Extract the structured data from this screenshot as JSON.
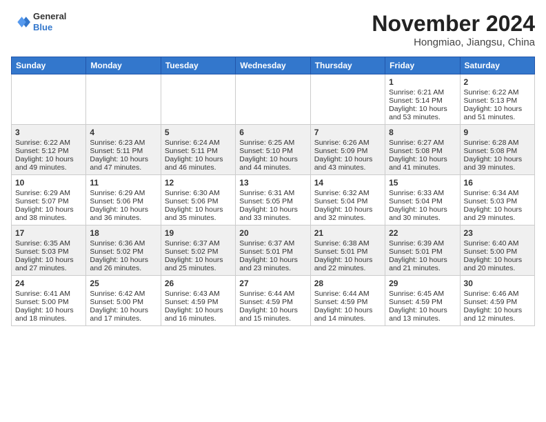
{
  "header": {
    "logo_line1": "General",
    "logo_line2": "Blue",
    "title": "November 2024",
    "subtitle": "Hongmiao, Jiangsu, China"
  },
  "weekdays": [
    "Sunday",
    "Monday",
    "Tuesday",
    "Wednesday",
    "Thursday",
    "Friday",
    "Saturday"
  ],
  "weeks": [
    [
      {
        "day": "",
        "info": ""
      },
      {
        "day": "",
        "info": ""
      },
      {
        "day": "",
        "info": ""
      },
      {
        "day": "",
        "info": ""
      },
      {
        "day": "",
        "info": ""
      },
      {
        "day": "1",
        "info": "Sunrise: 6:21 AM\nSunset: 5:14 PM\nDaylight: 10 hours\nand 53 minutes."
      },
      {
        "day": "2",
        "info": "Sunrise: 6:22 AM\nSunset: 5:13 PM\nDaylight: 10 hours\nand 51 minutes."
      }
    ],
    [
      {
        "day": "3",
        "info": "Sunrise: 6:22 AM\nSunset: 5:12 PM\nDaylight: 10 hours\nand 49 minutes."
      },
      {
        "day": "4",
        "info": "Sunrise: 6:23 AM\nSunset: 5:11 PM\nDaylight: 10 hours\nand 47 minutes."
      },
      {
        "day": "5",
        "info": "Sunrise: 6:24 AM\nSunset: 5:11 PM\nDaylight: 10 hours\nand 46 minutes."
      },
      {
        "day": "6",
        "info": "Sunrise: 6:25 AM\nSunset: 5:10 PM\nDaylight: 10 hours\nand 44 minutes."
      },
      {
        "day": "7",
        "info": "Sunrise: 6:26 AM\nSunset: 5:09 PM\nDaylight: 10 hours\nand 43 minutes."
      },
      {
        "day": "8",
        "info": "Sunrise: 6:27 AM\nSunset: 5:08 PM\nDaylight: 10 hours\nand 41 minutes."
      },
      {
        "day": "9",
        "info": "Sunrise: 6:28 AM\nSunset: 5:08 PM\nDaylight: 10 hours\nand 39 minutes."
      }
    ],
    [
      {
        "day": "10",
        "info": "Sunrise: 6:29 AM\nSunset: 5:07 PM\nDaylight: 10 hours\nand 38 minutes."
      },
      {
        "day": "11",
        "info": "Sunrise: 6:29 AM\nSunset: 5:06 PM\nDaylight: 10 hours\nand 36 minutes."
      },
      {
        "day": "12",
        "info": "Sunrise: 6:30 AM\nSunset: 5:06 PM\nDaylight: 10 hours\nand 35 minutes."
      },
      {
        "day": "13",
        "info": "Sunrise: 6:31 AM\nSunset: 5:05 PM\nDaylight: 10 hours\nand 33 minutes."
      },
      {
        "day": "14",
        "info": "Sunrise: 6:32 AM\nSunset: 5:04 PM\nDaylight: 10 hours\nand 32 minutes."
      },
      {
        "day": "15",
        "info": "Sunrise: 6:33 AM\nSunset: 5:04 PM\nDaylight: 10 hours\nand 30 minutes."
      },
      {
        "day": "16",
        "info": "Sunrise: 6:34 AM\nSunset: 5:03 PM\nDaylight: 10 hours\nand 29 minutes."
      }
    ],
    [
      {
        "day": "17",
        "info": "Sunrise: 6:35 AM\nSunset: 5:03 PM\nDaylight: 10 hours\nand 27 minutes."
      },
      {
        "day": "18",
        "info": "Sunrise: 6:36 AM\nSunset: 5:02 PM\nDaylight: 10 hours\nand 26 minutes."
      },
      {
        "day": "19",
        "info": "Sunrise: 6:37 AM\nSunset: 5:02 PM\nDaylight: 10 hours\nand 25 minutes."
      },
      {
        "day": "20",
        "info": "Sunrise: 6:37 AM\nSunset: 5:01 PM\nDaylight: 10 hours\nand 23 minutes."
      },
      {
        "day": "21",
        "info": "Sunrise: 6:38 AM\nSunset: 5:01 PM\nDaylight: 10 hours\nand 22 minutes."
      },
      {
        "day": "22",
        "info": "Sunrise: 6:39 AM\nSunset: 5:01 PM\nDaylight: 10 hours\nand 21 minutes."
      },
      {
        "day": "23",
        "info": "Sunrise: 6:40 AM\nSunset: 5:00 PM\nDaylight: 10 hours\nand 20 minutes."
      }
    ],
    [
      {
        "day": "24",
        "info": "Sunrise: 6:41 AM\nSunset: 5:00 PM\nDaylight: 10 hours\nand 18 minutes."
      },
      {
        "day": "25",
        "info": "Sunrise: 6:42 AM\nSunset: 5:00 PM\nDaylight: 10 hours\nand 17 minutes."
      },
      {
        "day": "26",
        "info": "Sunrise: 6:43 AM\nSunset: 4:59 PM\nDaylight: 10 hours\nand 16 minutes."
      },
      {
        "day": "27",
        "info": "Sunrise: 6:44 AM\nSunset: 4:59 PM\nDaylight: 10 hours\nand 15 minutes."
      },
      {
        "day": "28",
        "info": "Sunrise: 6:44 AM\nSunset: 4:59 PM\nDaylight: 10 hours\nand 14 minutes."
      },
      {
        "day": "29",
        "info": "Sunrise: 6:45 AM\nSunset: 4:59 PM\nDaylight: 10 hours\nand 13 minutes."
      },
      {
        "day": "30",
        "info": "Sunrise: 6:46 AM\nSunset: 4:59 PM\nDaylight: 10 hours\nand 12 minutes."
      }
    ]
  ]
}
